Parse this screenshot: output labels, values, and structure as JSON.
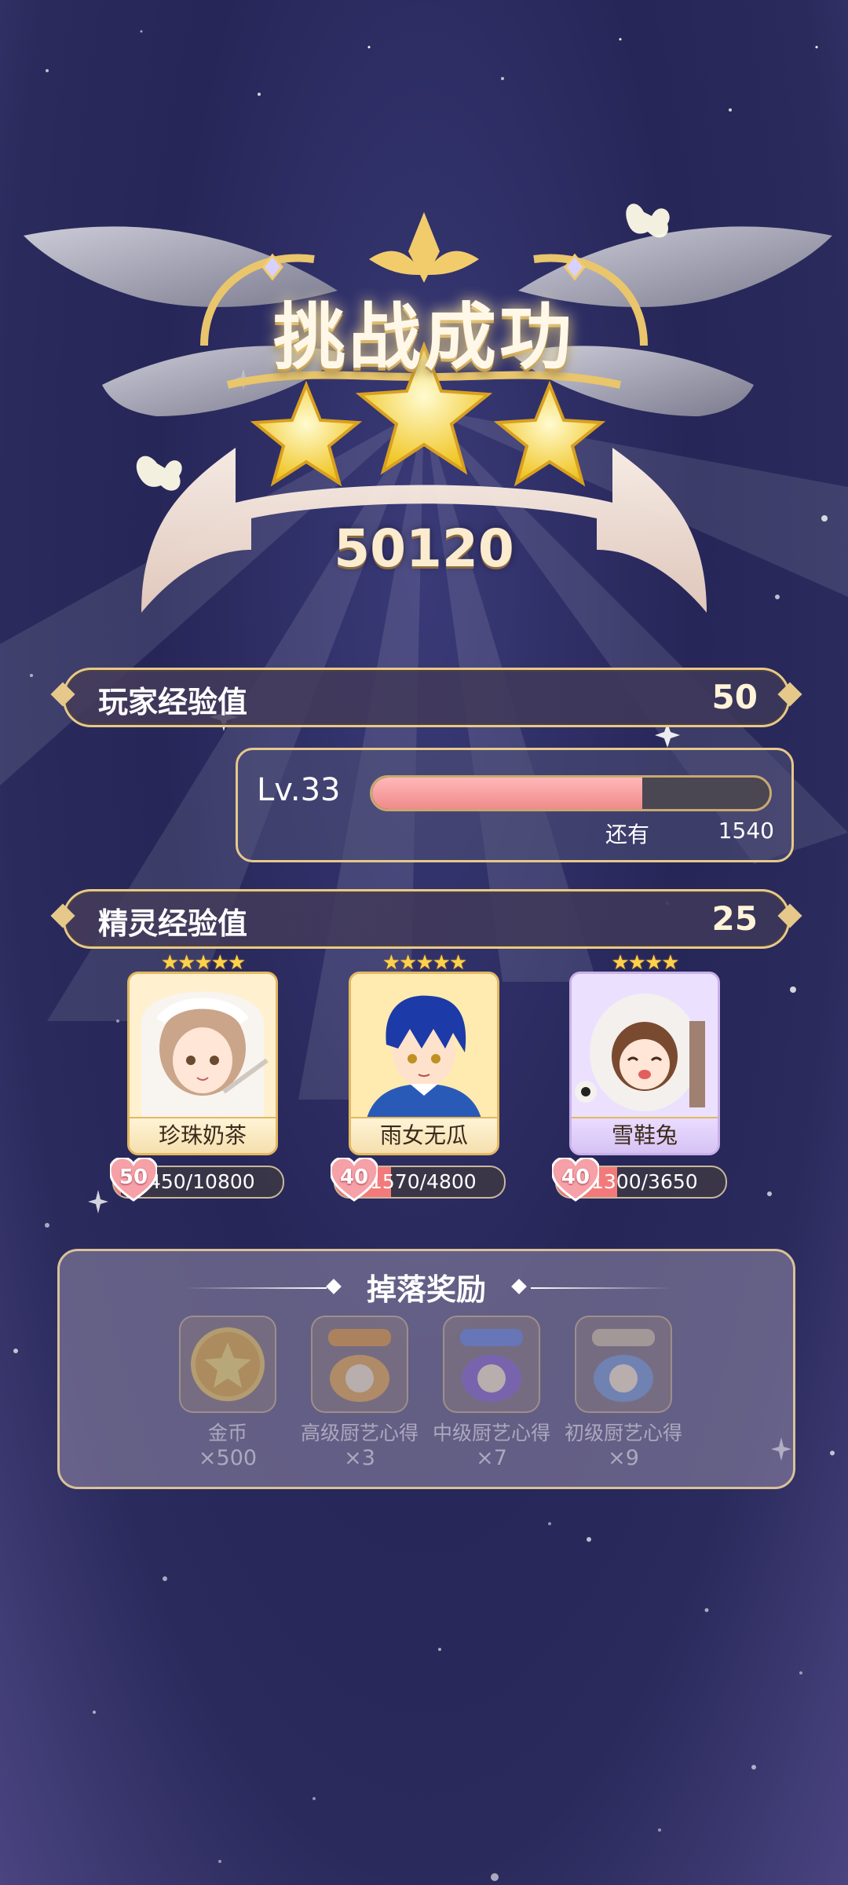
{
  "result": {
    "title": "挑战成功",
    "star_count": 3,
    "score": "50120"
  },
  "player_exp": {
    "label": "玩家经验值",
    "value": "50",
    "level": "Lv.33",
    "progress": 0.68,
    "remain_label": "还有",
    "remain_value": "1540"
  },
  "spirit_exp": {
    "label": "精灵经验值",
    "value": "25"
  },
  "spirits": [
    {
      "name": "珍珠奶茶",
      "stars": "★★★★★",
      "level": "50",
      "exp": "450/10800",
      "progress": 0.04
    },
    {
      "name": "雨女无瓜",
      "stars": "★★★★★",
      "level": "40",
      "exp": "1570/4800",
      "progress": 0.33
    },
    {
      "name": "雪鞋兔",
      "stars": "★★★★",
      "level": "40",
      "exp": "1300/3650",
      "progress": 0.36
    }
  ],
  "rewards": {
    "title": "掉落奖励",
    "items": [
      {
        "name": "金币",
        "count": "×500",
        "icon": "gold-coin-icon"
      },
      {
        "name": "高级厨艺心得",
        "count": "×3",
        "icon": "cooking-scroll-icon"
      },
      {
        "name": "中级厨艺心得",
        "count": "×7",
        "icon": "cooking-scroll-icon"
      },
      {
        "name": "初级厨艺心得",
        "count": "×9",
        "icon": "cooking-scroll-icon"
      }
    ]
  }
}
